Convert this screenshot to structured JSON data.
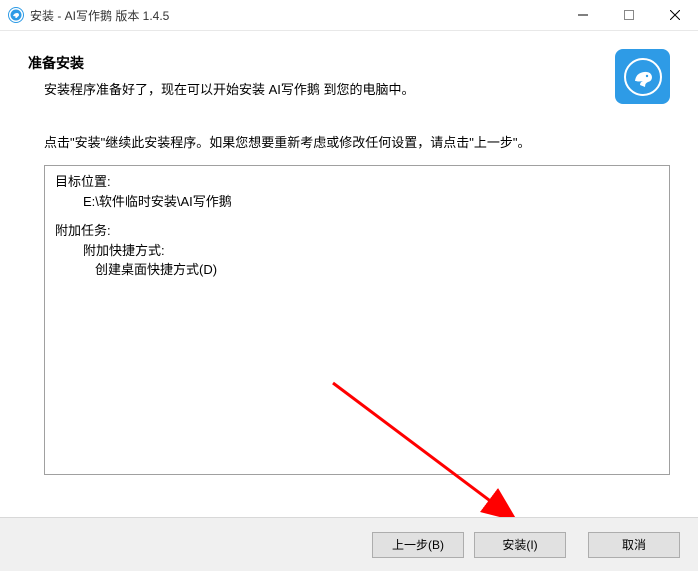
{
  "titlebar": {
    "text": "安装 - AI写作鹅 版本 1.4.5"
  },
  "header": {
    "heading": "准备安装",
    "subheading": "安装程序准备好了，现在可以开始安装 AI写作鹅 到您的电脑中。"
  },
  "instruction": "点击\"安装\"继续此安装程序。如果您想要重新考虑或修改任何设置，请点击\"上一步\"。",
  "summary": {
    "dest_label": "目标位置:",
    "dest_value": "E:\\软件临时安装\\AI写作鹅",
    "tasks_label": "附加任务:",
    "shortcuts_label": "附加快捷方式:",
    "desktop_shortcut": "创建桌面快捷方式(D)"
  },
  "buttons": {
    "back": "上一步(B)",
    "install": "安装(I)",
    "cancel": "取消"
  }
}
